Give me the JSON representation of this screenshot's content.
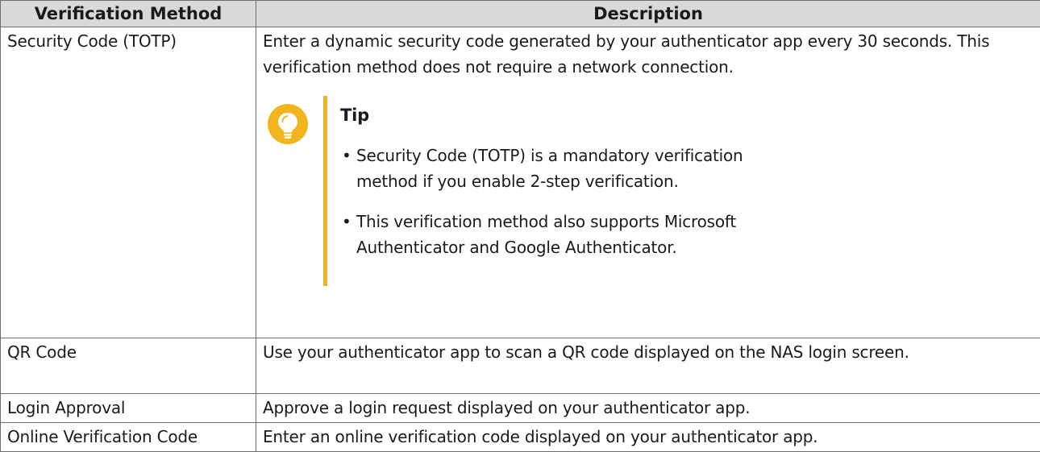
{
  "headers": {
    "method": "Verification Method",
    "description": "Description"
  },
  "rows": [
    {
      "method": "Security Code (TOTP)",
      "description": "Enter a dynamic security code generated by your authenticator app every 30 seconds. This verification method does not require a network connection.",
      "tip": {
        "icon": "lightbulb-icon",
        "accent_color": "#f2b51d",
        "title": "Tip",
        "items": [
          "Security Code (TOTP) is a mandatory verification method if you enable 2-step verification.",
          "This verification method also supports Microsoft Authenticator and Google Authenticator."
        ]
      }
    },
    {
      "method": "QR Code",
      "description": "Use your authenticator app to scan a QR code displayed on the NAS login screen."
    },
    {
      "method": "Login Approval",
      "description": "Approve a login request displayed on your authenticator app."
    },
    {
      "method": "Online Verification Code",
      "description": "Enter an online verification code displayed on your authenticator app."
    }
  ],
  "colors": {
    "header_background": "#d9d9d9",
    "border": "#6e6e6e",
    "tip_accent": "#f2b51d"
  }
}
